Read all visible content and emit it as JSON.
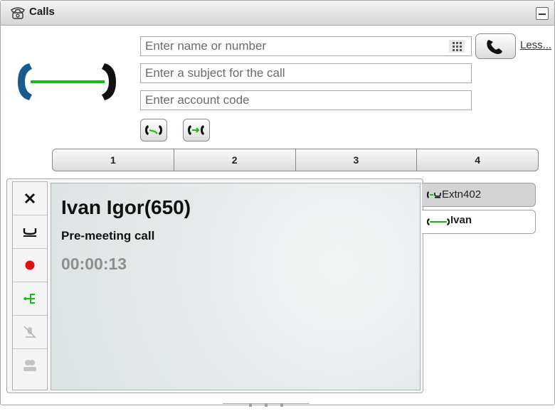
{
  "window": {
    "title": "Calls"
  },
  "icons": {
    "title": "telephone-icon",
    "hero": "call-connected-icon",
    "keypad": "dialpad-icon",
    "call": "handset-icon",
    "transfer_a": "transfer-icon",
    "transfer_b": "conference-icon",
    "toolbar": [
      "hangup-icon",
      "hold-icon",
      "record-icon",
      "redirect-icon",
      "mute-icon",
      "listen-icon"
    ]
  },
  "inputs": {
    "number_placeholder": "Enter name or number",
    "subject_placeholder": "Enter a subject for the call",
    "account_placeholder": "Enter account code"
  },
  "links": {
    "less": "Less..."
  },
  "tabs": [
    "1",
    "2",
    "3",
    "4"
  ],
  "active_call": {
    "name": "Ivan Igor(650)",
    "subject": "Pre-meeting call",
    "duration": "00:00:13"
  },
  "queue": [
    {
      "label": "Extn402",
      "state": "held"
    },
    {
      "label": "Ivan",
      "state": "connected"
    }
  ],
  "colors": {
    "accent_green": "#18b918",
    "record_red": "#e01010",
    "handset_blue": "#1c5a8c",
    "timer_gray": "#8e8e8e"
  }
}
